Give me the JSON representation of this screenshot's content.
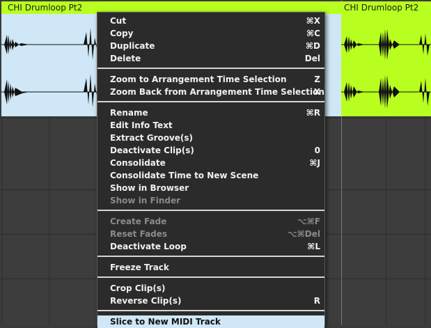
{
  "clips": {
    "left_title": "CHI Drumloop Pt2",
    "right_title": "CHI Drumloop Pt2"
  },
  "menu": {
    "items": [
      {
        "label": "Cut",
        "shortcut": "⌘X",
        "enabled": true
      },
      {
        "label": "Copy",
        "shortcut": "⌘C",
        "enabled": true
      },
      {
        "label": "Duplicate",
        "shortcut": "⌘D",
        "enabled": true
      },
      {
        "label": "Delete",
        "shortcut": "Del",
        "enabled": true
      },
      {
        "label": "Zoom to Arrangement Time Selection",
        "shortcut": "Z",
        "enabled": true
      },
      {
        "label": "Zoom Back from Arrangement Time Selection",
        "shortcut": "X",
        "enabled": true
      },
      {
        "label": "Rename",
        "shortcut": "⌘R",
        "enabled": true
      },
      {
        "label": "Edit Info Text",
        "shortcut": "",
        "enabled": true
      },
      {
        "label": "Extract Groove(s)",
        "shortcut": "",
        "enabled": true
      },
      {
        "label": "Deactivate Clip(s)",
        "shortcut": "0",
        "enabled": true
      },
      {
        "label": "Consolidate",
        "shortcut": "⌘J",
        "enabled": true
      },
      {
        "label": "Consolidate Time to New Scene",
        "shortcut": "",
        "enabled": true
      },
      {
        "label": "Show in Browser",
        "shortcut": "",
        "enabled": true
      },
      {
        "label": "Show in Finder",
        "shortcut": "",
        "enabled": false
      },
      {
        "label": "Create Fade",
        "shortcut": "⌥⌘F",
        "enabled": false
      },
      {
        "label": "Reset Fades",
        "shortcut": "⌥⌘Del",
        "enabled": false
      },
      {
        "label": "Deactivate Loop",
        "shortcut": "⌘L",
        "enabled": true
      },
      {
        "label": "Freeze Track",
        "shortcut": "",
        "enabled": true
      },
      {
        "label": "Crop Clip(s)",
        "shortcut": "",
        "enabled": true
      },
      {
        "label": "Reverse Clip(s)",
        "shortcut": "R",
        "enabled": true
      },
      {
        "label": "Slice to New MIDI Track",
        "shortcut": "",
        "enabled": true,
        "highlighted": true
      }
    ]
  },
  "colors": {
    "clip_header": "#b8ff1f",
    "clip_left_body": "#cfe7f6",
    "clip_right_body": "#b8ff1f",
    "menu_bg": "#2b2b2b",
    "highlight": "#cfe7f6"
  }
}
